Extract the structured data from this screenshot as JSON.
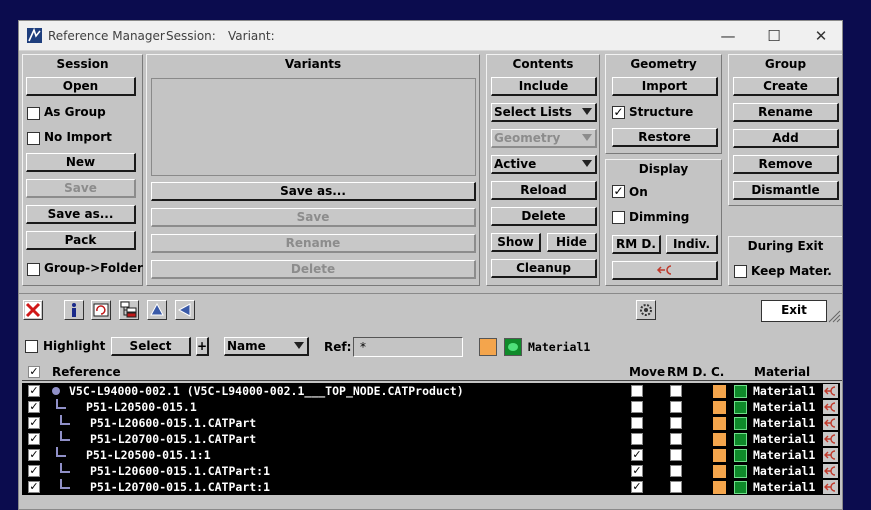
{
  "window": {
    "title": "Reference Manager",
    "session_label": "Session:",
    "variant_label": "Variant:",
    "controls": {
      "minimize": "—",
      "maximize": "☐",
      "close": "✕"
    }
  },
  "session": {
    "header": "Session",
    "open": "Open",
    "as_group": "As Group",
    "no_import": "No Import",
    "new": "New",
    "save": "Save",
    "save_as": "Save as...",
    "pack": "Pack",
    "group_folder": "Group->Folder"
  },
  "variants": {
    "header": "Variants",
    "save_as": "Save as...",
    "save": "Save",
    "rename": "Rename",
    "delete": "Delete"
  },
  "contents": {
    "header": "Contents",
    "include": "Include",
    "select_lists": "Select Lists",
    "geometry": "Geometry",
    "active": "Active",
    "reload": "Reload",
    "delete": "Delete",
    "show": "Show",
    "hide": "Hide",
    "cleanup": "Cleanup"
  },
  "geometry": {
    "header": "Geometry",
    "import": "Import",
    "structure": "Structure",
    "structure_checked": true,
    "restore": "Restore"
  },
  "display": {
    "header": "Display",
    "on": "On",
    "on_checked": true,
    "dimming": "Dimming",
    "rm_d": "RM D.",
    "indiv": "Indiv."
  },
  "group": {
    "header": "Group",
    "create": "Create",
    "rename": "Rename",
    "add": "Add",
    "remove": "Remove",
    "dismantle": "Dismantle"
  },
  "during_exit": {
    "header": "During Exit",
    "keep_mater": "Keep Mater."
  },
  "toolbar": {
    "exit": "Exit",
    "icons": [
      "delete-icon",
      "info-icon",
      "refresh-icon",
      "tree-icon",
      "up-arrow-icon",
      "left-arrow-icon",
      "settings-icon"
    ]
  },
  "filter": {
    "highlight": "Highlight",
    "select": "Select",
    "plus": "+",
    "name_option": "Name",
    "ref_label": "Ref:",
    "ref_value": "*",
    "material": "Material1",
    "swatch_color": "#f4a54c"
  },
  "table": {
    "headers": {
      "reference": "Reference",
      "move": "Move",
      "rm_d": "RM D.",
      "c": "C.",
      "material": "Material"
    },
    "rows": [
      {
        "name": "V5C-L94000-002.1 (V5C-L94000-002.1___TOP_NODE.CATProduct)",
        "move": false,
        "material": "Material1"
      },
      {
        "name": "P51-L20500-015.1",
        "move": false,
        "material": "Material1"
      },
      {
        "name": "P51-L20600-015.1.CATPart",
        "move": false,
        "material": "Material1"
      },
      {
        "name": "P51-L20700-015.1.CATPart",
        "move": false,
        "material": "Material1"
      },
      {
        "name": "P51-L20500-015.1:1",
        "move": true,
        "material": "Material1"
      },
      {
        "name": "P51-L20600-015.1.CATPart:1",
        "move": true,
        "material": "Material1"
      },
      {
        "name": "P51-L20700-015.1.CATPart:1",
        "move": true,
        "material": "Material1"
      }
    ]
  }
}
